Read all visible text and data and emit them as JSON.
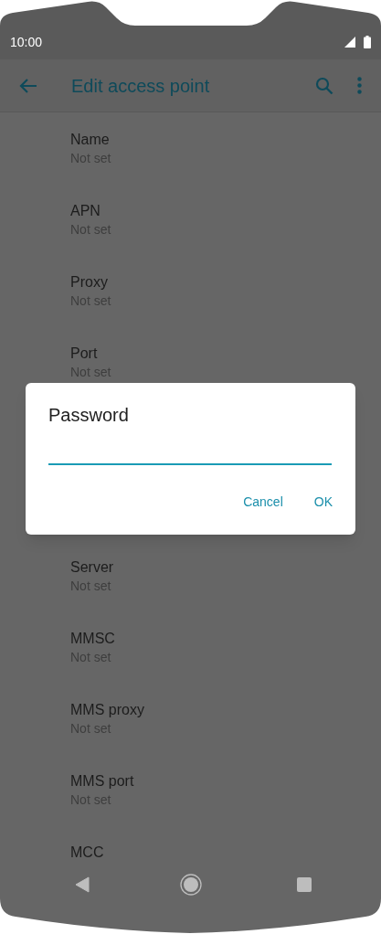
{
  "status_bar": {
    "time": "10:00"
  },
  "app_bar": {
    "title": "Edit access point"
  },
  "settings_above": [
    {
      "title": "Name",
      "value": "Not set"
    },
    {
      "title": "APN",
      "value": "Not set"
    },
    {
      "title": "Proxy",
      "value": "Not set"
    },
    {
      "title": "Port",
      "value": "Not set"
    }
  ],
  "settings_below": [
    {
      "title": "Server",
      "value": "Not set"
    },
    {
      "title": "MMSC",
      "value": "Not set"
    },
    {
      "title": "MMS proxy",
      "value": "Not set"
    },
    {
      "title": "MMS port",
      "value": "Not set"
    },
    {
      "title": "MCC"
    }
  ],
  "dialog": {
    "title": "Password",
    "buttons": [
      "Cancel",
      "OK"
    ]
  }
}
